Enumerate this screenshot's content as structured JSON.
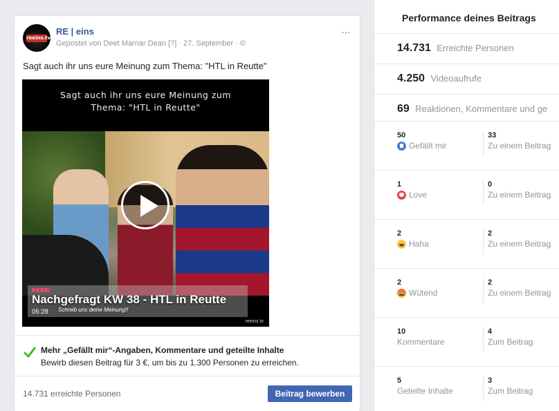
{
  "post": {
    "page_name": "RE | eins",
    "meta": "Gepostet von Deet Marnar Dean [?] · 27. September · ©",
    "more_icon": "…",
    "text": "Sagt auch ihr uns eure Meinung zum Thema: \"HTL in Reutte\"",
    "avatar_logo_text": "reeins.tv",
    "video": {
      "caption_line1": "Sagt auch ihr uns eure Meinung zum",
      "caption_line2": "Thema: \"HTL in Reutte\"",
      "headline": "Nachgefragt KW 38 - HTL in Reutte",
      "duration": "05:28",
      "subline": "Schreib uns deine Meinung!!",
      "watermark": "reeins.tv"
    },
    "promo": {
      "title": "Mehr „Gefällt mir“-Angaben, Kommentare und geteilte Inhalte",
      "subtitle": "Bewirb diesen Beitrag für 3 €, um bis zu 1.300 Personen zu erreichen."
    },
    "footer_reach": "14.731 erreichte Personen",
    "promote_button": "Beitrag bewerben"
  },
  "insights": {
    "title": "Performance deines Beitrags",
    "reach": {
      "value": "14.731",
      "label": "Erreichte Personen"
    },
    "video_views": {
      "value": "4.250",
      "label": "Videoaufrufe"
    },
    "engagement": {
      "value": "69",
      "label": "Reaktionen, Kommentare und ge"
    },
    "rows": [
      {
        "left_value": "50",
        "left_label": "Gefällt mir",
        "icon": "like-icon",
        "right_value": "33",
        "right_label": "Zu einem Beitrag"
      },
      {
        "left_value": "1",
        "left_label": "Love",
        "icon": "love-icon",
        "right_value": "0",
        "right_label": "Zu einem Beitrag"
      },
      {
        "left_value": "2",
        "left_label": "Haha",
        "icon": "haha-icon",
        "right_value": "2",
        "right_label": "Zu einem Beitrag"
      },
      {
        "left_value": "2",
        "left_label": "Wütend",
        "icon": "angry-icon",
        "right_value": "2",
        "right_label": "Zu einem Beitrag"
      },
      {
        "left_value": "10",
        "left_label": "Kommentare",
        "icon": "",
        "right_value": "4",
        "right_label": "Zum Beitrag"
      },
      {
        "left_value": "5",
        "left_label": "Geteilte Inhalte",
        "icon": "",
        "right_value": "3",
        "right_label": "Zum Beitrag"
      }
    ]
  },
  "colors": {
    "link": "#365899",
    "button": "#4267b2",
    "check": "#42b72a"
  }
}
